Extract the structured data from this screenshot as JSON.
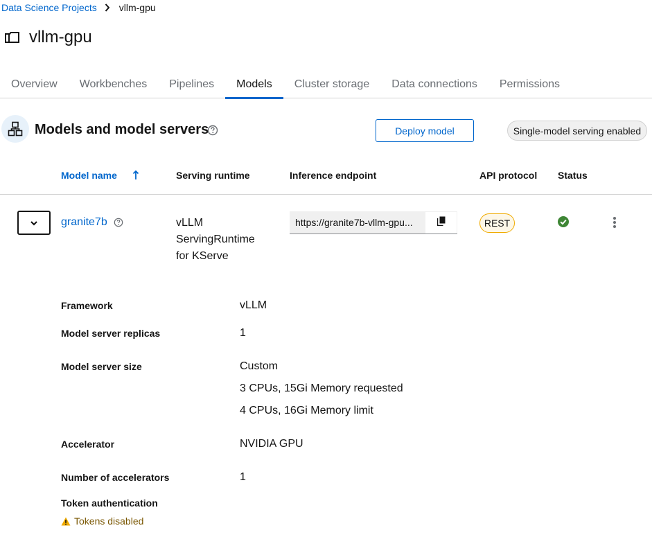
{
  "breadcrumb": {
    "parent": "Data Science Projects",
    "current": "vllm-gpu"
  },
  "page": {
    "title": "vllm-gpu"
  },
  "tabs": [
    {
      "label": "Overview",
      "active": false
    },
    {
      "label": "Workbenches",
      "active": false
    },
    {
      "label": "Pipelines",
      "active": false
    },
    {
      "label": "Models",
      "active": true
    },
    {
      "label": "Cluster storage",
      "active": false
    },
    {
      "label": "Data connections",
      "active": false
    },
    {
      "label": "Permissions",
      "active": false
    }
  ],
  "section": {
    "title": "Models and model servers",
    "deploy_label": "Deploy model",
    "serving_badge": "Single-model serving enabled"
  },
  "table": {
    "headers": {
      "model_name": "Model name",
      "serving_runtime": "Serving runtime",
      "inference_endpoint": "Inference endpoint",
      "api_protocol": "API protocol",
      "status": "Status"
    },
    "row": {
      "model_name": "granite7b",
      "runtime_lines": [
        "vLLM",
        "ServingRuntime",
        "for KServe"
      ],
      "endpoint": "https://granite7b-vllm-gpu...",
      "protocol": "REST",
      "status_icon": "check-circle-icon"
    }
  },
  "details": {
    "framework_label": "Framework",
    "framework_value": "vLLM",
    "replicas_label": "Model server replicas",
    "replicas_value": "1",
    "size_label": "Model server size",
    "size_lines": [
      "Custom",
      "3 CPUs, 15Gi Memory requested",
      "4 CPUs, 16Gi Memory limit"
    ],
    "accelerator_label": "Accelerator",
    "accelerator_value": "NVIDIA GPU",
    "num_accelerators_label": "Number of accelerators",
    "num_accelerators_value": "1",
    "token_auth_label": "Token authentication",
    "token_status": "Tokens disabled"
  },
  "colors": {
    "link": "#0066cc",
    "success": "#3e8635",
    "warning": "#f0ab00",
    "warning_text": "#795600",
    "tab_active_border": "#0066cc"
  }
}
